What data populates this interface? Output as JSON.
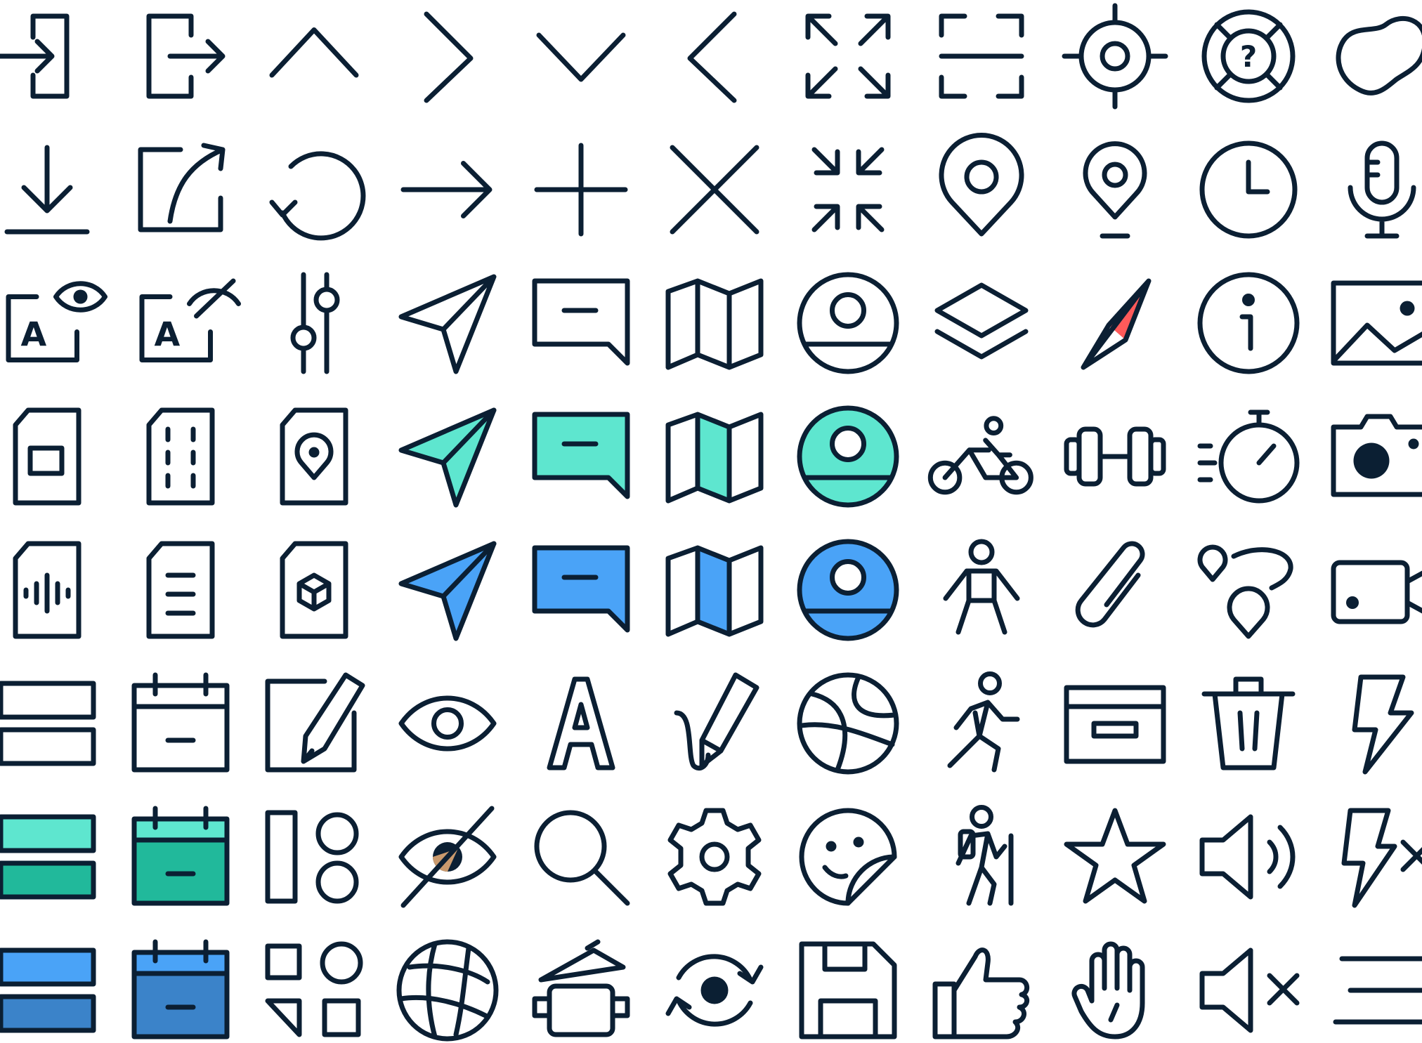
{
  "colors": {
    "ink": "#0b1f33",
    "teal": "#5ee6cf",
    "teal_dark": "#21b99b",
    "blue": "#4aa3f7",
    "blue_dark": "#3b83c9",
    "red": "#ff5a5a"
  },
  "text_marks": {
    "letter_a": "A",
    "question": "?"
  },
  "icons": [
    "sign-in-icon",
    "sign-out-icon",
    "chevron-up-icon",
    "chevron-right-icon",
    "chevron-down-icon",
    "chevron-left-icon",
    "expand-icon",
    "scan-frame-icon",
    "crosshair-icon",
    "help-buoy-icon",
    "blob-shape-icon",
    "download-icon",
    "external-link-icon",
    "refresh-icon",
    "arrow-right-icon",
    "plus-icon",
    "close-icon",
    "collapse-icon",
    "location-pin-icon",
    "place-marker-icon",
    "clock-icon",
    "microphone-icon",
    "text-visible-icon",
    "text-hidden-icon",
    "sliders-icon",
    "send-icon",
    "comment-icon",
    "map-icon",
    "user-circle-icon",
    "layers-icon",
    "compass-icon",
    "info-icon",
    "image-icon",
    "image-file-icon",
    "film-file-icon",
    "location-file-icon",
    "send-teal-icon",
    "comment-teal-icon",
    "map-teal-icon",
    "user-circle-teal-icon",
    "cycling-icon",
    "dumbbell-icon",
    "stopwatch-icon",
    "camera-icon",
    "audio-file-icon",
    "text-file-icon",
    "3d-file-icon",
    "send-blue-icon",
    "comment-blue-icon",
    "map-blue-icon",
    "user-circle-blue-icon",
    "person-standing-icon",
    "paperclip-icon",
    "route-icon",
    "video-camera-icon",
    "rows-icon",
    "calendar-icon",
    "edit-icon",
    "eye-icon",
    "letter-a-icon",
    "pencil-draw-icon",
    "globe-icon",
    "walking-icon",
    "archive-box-icon",
    "trash-icon",
    "flash-icon",
    "rows-teal-icon",
    "calendar-teal-icon",
    "shapes-icon",
    "eye-off-icon",
    "search-icon",
    "gear-icon",
    "sticker-smiley-icon",
    "hiking-icon",
    "star-icon",
    "volume-icon",
    "flash-off-icon",
    "rows-blue-icon",
    "calendar-blue-icon",
    "categories-icon",
    "globe-grid-icon",
    "cooking-pot-icon",
    "sync-icon",
    "save-icon",
    "thumbs-up-icon",
    "hand-icon",
    "mute-icon",
    "menu-icon"
  ]
}
